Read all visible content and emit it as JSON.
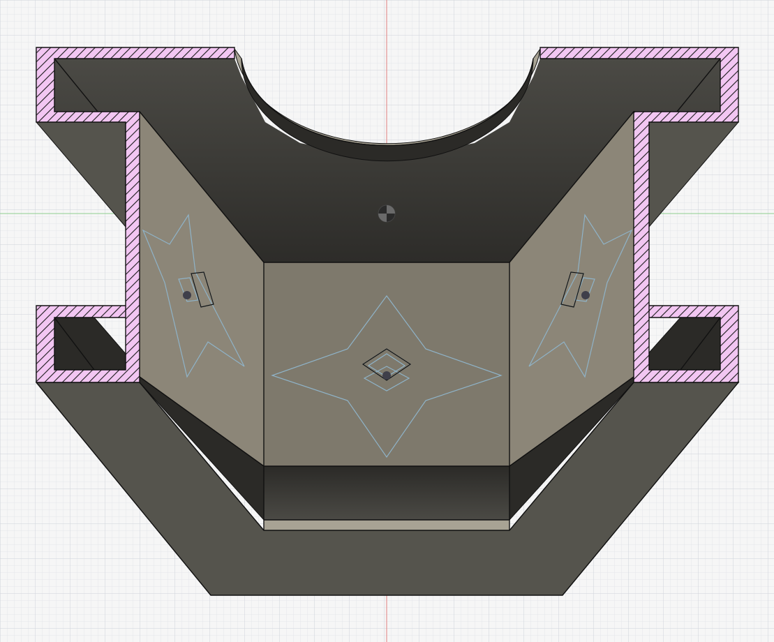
{
  "viewport": {
    "background": "#f6f6f6",
    "grid_minor_color": "#e4e6ea",
    "grid_major_color": "#cfd3da",
    "x_axis_color": "#e08080",
    "y_axis_color": "#8fcf8f"
  },
  "model": {
    "section_fill": "#f2c6f2",
    "section_hatch_color": "#1a1a1a",
    "edge_color": "#111111",
    "face_colors": {
      "outer_front": "#55544d",
      "back_wall_top": "#2d2c29",
      "back_wall_bottom": "#4b4a45",
      "side_wall": "#8c8678",
      "floor": "#7e796c",
      "lip_inner": "#2b2a27",
      "rim": "#a8a394"
    }
  },
  "sketch": {
    "line_color": "#8fb3c8",
    "origin_marker_icon": "origin-icon"
  }
}
